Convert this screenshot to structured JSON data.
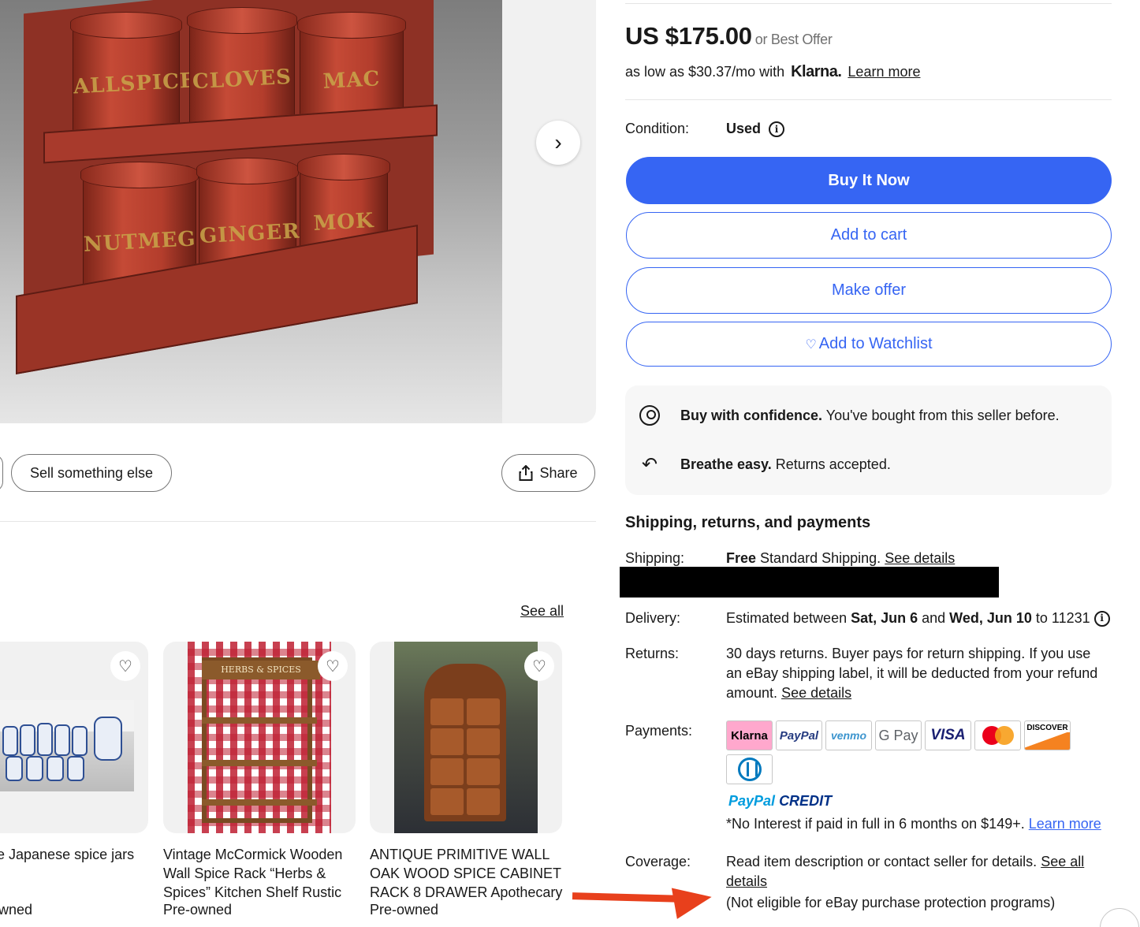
{
  "gallery": {
    "canister_labels_top": [
      "ALLSPICE",
      "CLOVES",
      "MAC"
    ],
    "canister_labels_bottom": [
      "NUTMEG",
      "GINGER",
      "MOK"
    ]
  },
  "actions": {
    "sell_label": "Sell something else",
    "share_label": "Share"
  },
  "similar": {
    "see_all": "See all",
    "items": [
      {
        "title_lines": [
          "e Japanese spice jars",
          ""
        ],
        "condition": "wned"
      },
      {
        "title_lines": [
          "Vintage McCormick Wooden",
          "Wall Spice Rack “Herbs &",
          "Spices” Kitchen Shelf Rustic"
        ],
        "condition": "Pre-owned"
      },
      {
        "title_lines": [
          "ANTIQUE PRIMITIVE WALL",
          "OAK WOOD SPICE CABINET",
          "RACK 8 DRAWER Apothecary"
        ],
        "condition": "Pre-owned"
      }
    ],
    "rack_sign": "HERBS & SPICES"
  },
  "listing": {
    "price": "US $175.00",
    "best_offer": "or Best Offer",
    "klarna_prefix": "as low as $30.37/mo with",
    "klarna_logo": "Klarna.",
    "klarna_learn_more": "Learn more",
    "condition_label": "Condition:",
    "condition_value": "Used",
    "buy_now": "Buy It Now",
    "add_to_cart": "Add to cart",
    "make_offer": "Make offer",
    "add_to_watchlist": "Add to Watchlist"
  },
  "confidence": {
    "row1_bold": "Buy with confidence.",
    "row1_text": "You've bought from this seller before.",
    "row2_bold": "Breathe easy.",
    "row2_text": "Returns accepted."
  },
  "shipping": {
    "heading": "Shipping, returns, and payments",
    "shipping_label": "Shipping:",
    "shipping_bold": "Free",
    "shipping_text": "Standard Shipping.",
    "shipping_link": "See details",
    "delivery_label": "Delivery:",
    "delivery_prefix": "Estimated between",
    "delivery_start": "Sat, Jun 6",
    "delivery_and": "and",
    "delivery_end": "Wed, Jun 10",
    "delivery_suffix": "to 11231",
    "returns_label": "Returns:",
    "returns_text": "30 days returns. Buyer pays for return shipping. If you use an eBay shipping label, it will be deducted from your refund amount.",
    "returns_link": "See details",
    "payments_label": "Payments:",
    "payment_badges": [
      "Klarna",
      "PayPal",
      "venmo",
      "G Pay",
      "VISA",
      "mastercard",
      "DISCOVER",
      "Diners Club"
    ],
    "paypal_credit_a": "PayPal",
    "paypal_credit_b": "CREDIT",
    "credit_text": "*No Interest if paid in full in 6 months on $149+.",
    "credit_link": "Learn more",
    "coverage_label": "Coverage:",
    "coverage_text": "Read item description or contact seller for details.",
    "coverage_link": "See all details",
    "coverage_note": "(Not eligible for eBay purchase protection programs)"
  },
  "colors": {
    "accent": "#3665f3",
    "annotation_arrow": "#e8401c",
    "redaction": "#000000"
  }
}
